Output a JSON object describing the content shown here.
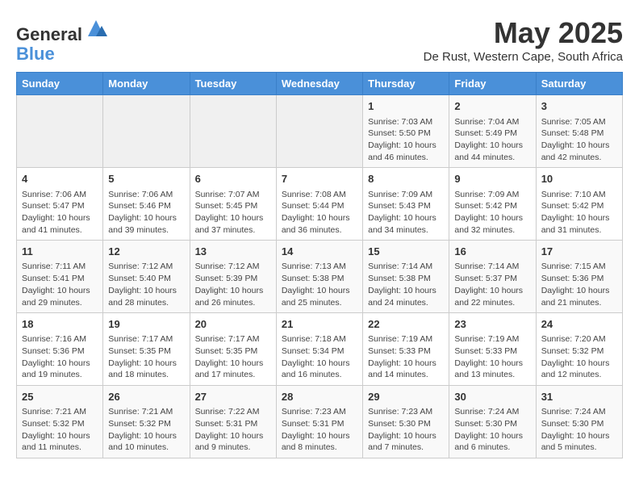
{
  "header": {
    "logo_line1": "General",
    "logo_line2": "Blue",
    "month_title": "May 2025",
    "location": "De Rust, Western Cape, South Africa"
  },
  "weekdays": [
    "Sunday",
    "Monday",
    "Tuesday",
    "Wednesday",
    "Thursday",
    "Friday",
    "Saturday"
  ],
  "weeks": [
    [
      {
        "day": "",
        "info": ""
      },
      {
        "day": "",
        "info": ""
      },
      {
        "day": "",
        "info": ""
      },
      {
        "day": "",
        "info": ""
      },
      {
        "day": "1",
        "info": "Sunrise: 7:03 AM\nSunset: 5:50 PM\nDaylight: 10 hours and 46 minutes."
      },
      {
        "day": "2",
        "info": "Sunrise: 7:04 AM\nSunset: 5:49 PM\nDaylight: 10 hours and 44 minutes."
      },
      {
        "day": "3",
        "info": "Sunrise: 7:05 AM\nSunset: 5:48 PM\nDaylight: 10 hours and 42 minutes."
      }
    ],
    [
      {
        "day": "4",
        "info": "Sunrise: 7:06 AM\nSunset: 5:47 PM\nDaylight: 10 hours and 41 minutes."
      },
      {
        "day": "5",
        "info": "Sunrise: 7:06 AM\nSunset: 5:46 PM\nDaylight: 10 hours and 39 minutes."
      },
      {
        "day": "6",
        "info": "Sunrise: 7:07 AM\nSunset: 5:45 PM\nDaylight: 10 hours and 37 minutes."
      },
      {
        "day": "7",
        "info": "Sunrise: 7:08 AM\nSunset: 5:44 PM\nDaylight: 10 hours and 36 minutes."
      },
      {
        "day": "8",
        "info": "Sunrise: 7:09 AM\nSunset: 5:43 PM\nDaylight: 10 hours and 34 minutes."
      },
      {
        "day": "9",
        "info": "Sunrise: 7:09 AM\nSunset: 5:42 PM\nDaylight: 10 hours and 32 minutes."
      },
      {
        "day": "10",
        "info": "Sunrise: 7:10 AM\nSunset: 5:42 PM\nDaylight: 10 hours and 31 minutes."
      }
    ],
    [
      {
        "day": "11",
        "info": "Sunrise: 7:11 AM\nSunset: 5:41 PM\nDaylight: 10 hours and 29 minutes."
      },
      {
        "day": "12",
        "info": "Sunrise: 7:12 AM\nSunset: 5:40 PM\nDaylight: 10 hours and 28 minutes."
      },
      {
        "day": "13",
        "info": "Sunrise: 7:12 AM\nSunset: 5:39 PM\nDaylight: 10 hours and 26 minutes."
      },
      {
        "day": "14",
        "info": "Sunrise: 7:13 AM\nSunset: 5:38 PM\nDaylight: 10 hours and 25 minutes."
      },
      {
        "day": "15",
        "info": "Sunrise: 7:14 AM\nSunset: 5:38 PM\nDaylight: 10 hours and 24 minutes."
      },
      {
        "day": "16",
        "info": "Sunrise: 7:14 AM\nSunset: 5:37 PM\nDaylight: 10 hours and 22 minutes."
      },
      {
        "day": "17",
        "info": "Sunrise: 7:15 AM\nSunset: 5:36 PM\nDaylight: 10 hours and 21 minutes."
      }
    ],
    [
      {
        "day": "18",
        "info": "Sunrise: 7:16 AM\nSunset: 5:36 PM\nDaylight: 10 hours and 19 minutes."
      },
      {
        "day": "19",
        "info": "Sunrise: 7:17 AM\nSunset: 5:35 PM\nDaylight: 10 hours and 18 minutes."
      },
      {
        "day": "20",
        "info": "Sunrise: 7:17 AM\nSunset: 5:35 PM\nDaylight: 10 hours and 17 minutes."
      },
      {
        "day": "21",
        "info": "Sunrise: 7:18 AM\nSunset: 5:34 PM\nDaylight: 10 hours and 16 minutes."
      },
      {
        "day": "22",
        "info": "Sunrise: 7:19 AM\nSunset: 5:33 PM\nDaylight: 10 hours and 14 minutes."
      },
      {
        "day": "23",
        "info": "Sunrise: 7:19 AM\nSunset: 5:33 PM\nDaylight: 10 hours and 13 minutes."
      },
      {
        "day": "24",
        "info": "Sunrise: 7:20 AM\nSunset: 5:32 PM\nDaylight: 10 hours and 12 minutes."
      }
    ],
    [
      {
        "day": "25",
        "info": "Sunrise: 7:21 AM\nSunset: 5:32 PM\nDaylight: 10 hours and 11 minutes."
      },
      {
        "day": "26",
        "info": "Sunrise: 7:21 AM\nSunset: 5:32 PM\nDaylight: 10 hours and 10 minutes."
      },
      {
        "day": "27",
        "info": "Sunrise: 7:22 AM\nSunset: 5:31 PM\nDaylight: 10 hours and 9 minutes."
      },
      {
        "day": "28",
        "info": "Sunrise: 7:23 AM\nSunset: 5:31 PM\nDaylight: 10 hours and 8 minutes."
      },
      {
        "day": "29",
        "info": "Sunrise: 7:23 AM\nSunset: 5:30 PM\nDaylight: 10 hours and 7 minutes."
      },
      {
        "day": "30",
        "info": "Sunrise: 7:24 AM\nSunset: 5:30 PM\nDaylight: 10 hours and 6 minutes."
      },
      {
        "day": "31",
        "info": "Sunrise: 7:24 AM\nSunset: 5:30 PM\nDaylight: 10 hours and 5 minutes."
      }
    ]
  ]
}
